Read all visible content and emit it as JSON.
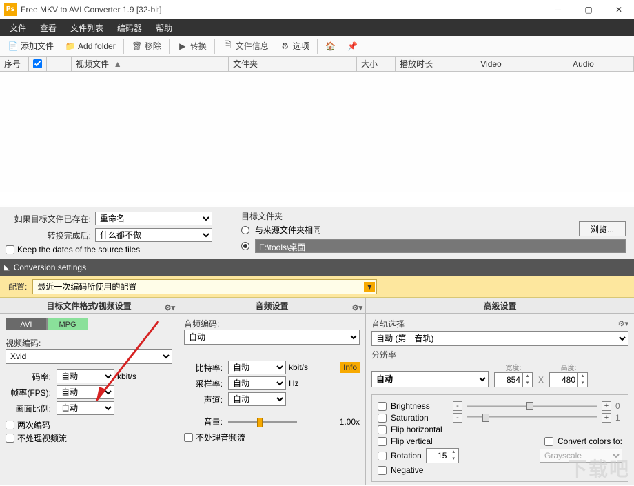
{
  "title": "Free MKV to AVI Converter 1.9  [32-bit]",
  "menu": [
    "文件",
    "查看",
    "文件列表",
    "编码器",
    "帮助"
  ],
  "toolbar": {
    "add_file": "添加文件",
    "add_folder": "Add folder",
    "remove": "移除",
    "convert": "转换",
    "file_info": "文件信息",
    "options": "选项"
  },
  "columns": {
    "num": "序号",
    "file": "视频文件",
    "folder": "文件夹",
    "size": "大小",
    "duration": "播放时长",
    "video": "Video",
    "audio": "Audio"
  },
  "bottom": {
    "if_exists_label": "如果目标文件已存在:",
    "if_exists": "重命名",
    "after_conv_label": "转换完成后:",
    "after_conv": "什么都不做",
    "keep_dates": "Keep the dates of the source files",
    "target_folder_label": "目标文件夹",
    "same_src": "与来源文件夹相同",
    "path": "E:\\tools\\桌面",
    "browse": "浏览..."
  },
  "section": "Conversion settings",
  "config": {
    "label": "配置:",
    "value": "最近一次编码所使用的配置"
  },
  "col1": {
    "title": "目标文件格式/视频设置",
    "tabs": [
      "AVI",
      "MPG"
    ],
    "codec_label": "视频编码:",
    "codec": "Xvid",
    "bitrate_label": "码率:",
    "bitrate": "自动",
    "bitrate_unit": "kbit/s",
    "fps_label": "帧率(FPS):",
    "fps": "自动",
    "aspect_label": "画面比例:",
    "aspect": "自动",
    "two_pass": "两次编码",
    "no_video": "不处理视频流"
  },
  "col2": {
    "title": "音频设置",
    "codec_label": "音频编码:",
    "codec": "自动",
    "bitrate_label": "比特率:",
    "bitrate": "自动",
    "bitrate_unit": "kbit/s",
    "sample_label": "采样率:",
    "sample": "自动",
    "sample_unit": "Hz",
    "channels_label": "声道:",
    "channels": "自动",
    "volume_label": "音量:",
    "volume": "1.00x",
    "info": "Info",
    "no_audio": "不处理音频流"
  },
  "col3": {
    "title": "高级设置",
    "track_label": "音轨选择",
    "track": "自动 (第一音轨)",
    "res_label": "分辨率",
    "res": "自动",
    "width_label": "宽度:",
    "width": "854",
    "height_label": "高度:",
    "height": "480",
    "x": "X",
    "brightness": "Brightness",
    "brightness_val": "0",
    "saturation": "Saturation",
    "saturation_val": "1",
    "flip_h": "Flip horizontal",
    "flip_v": "Flip vertical",
    "rotation": "Rotation",
    "rotation_val": "15",
    "convert_colors": "Convert colors to:",
    "grayscale": "Grayscale",
    "negative": "Negative"
  },
  "watermark": "下载吧"
}
